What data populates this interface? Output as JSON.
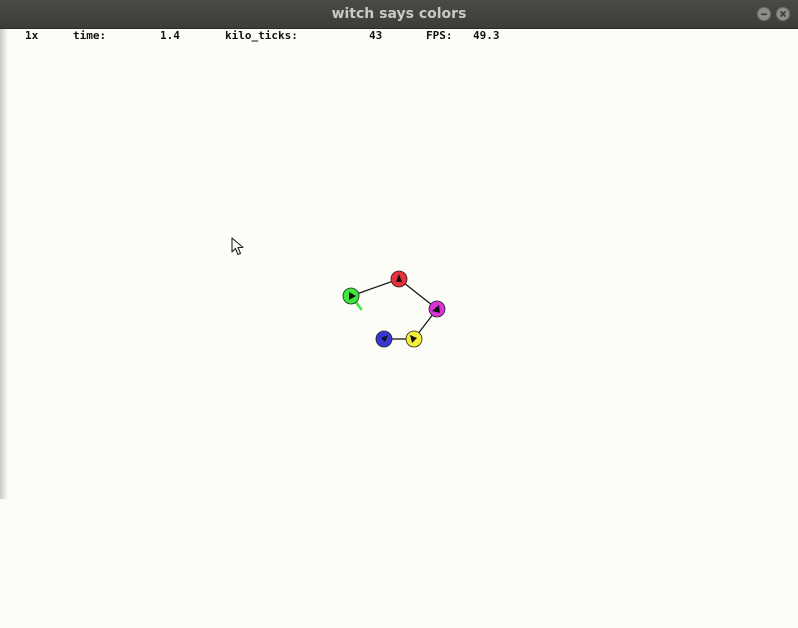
{
  "window": {
    "title": "witch says colors"
  },
  "hud": {
    "speed": "1x",
    "time_label": "time:",
    "time_value": "1.4",
    "ticks_label": "kilo_ticks:",
    "ticks_value": "43",
    "fps_label": "FPS:",
    "fps_value": "49.3"
  },
  "scene": {
    "agents": [
      {
        "name": "red",
        "color": "#e8303a"
      },
      {
        "name": "magenta",
        "color": "#d833d8"
      },
      {
        "name": "yellow",
        "color": "#f2ee3a"
      },
      {
        "name": "blue",
        "color": "#3838d8"
      },
      {
        "name": "green",
        "color": "#3ce83c"
      }
    ],
    "link_color": "#111111"
  },
  "icons": {
    "minimize": "minimize-icon",
    "close": "close-icon",
    "cursor": "mouse-pointer-icon"
  }
}
